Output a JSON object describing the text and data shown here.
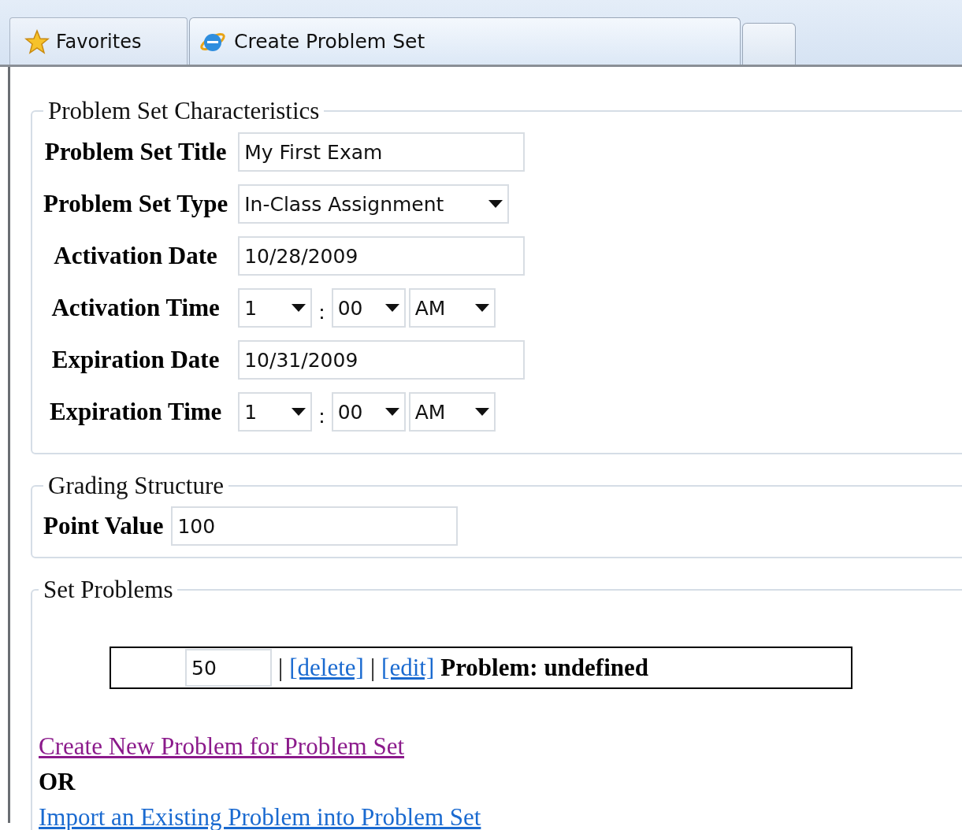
{
  "browser": {
    "favorites": "Favorites",
    "tabs": [
      {
        "title": "Create Problem Set",
        "selected": true
      }
    ]
  },
  "characteristics": {
    "legend": "Problem Set Characteristics",
    "fields": [
      {
        "kind": "text",
        "label": "Problem Set Title",
        "value": "My First Exam"
      },
      {
        "kind": "select",
        "label": "Problem Set Type",
        "value": "In-Class Assignment"
      },
      {
        "kind": "text",
        "label": "Activation Date",
        "value": "10/28/2009"
      },
      {
        "kind": "time",
        "label": "Activation Time",
        "hour": "1",
        "separator": ":",
        "minute": "00",
        "period": "AM"
      },
      {
        "kind": "text",
        "label": "Expiration Date",
        "value": "10/31/2009"
      },
      {
        "kind": "time",
        "label": "Expiration Time",
        "hour": "1",
        "separator": ":",
        "minute": "00",
        "period": "AM"
      }
    ]
  },
  "grading": {
    "legend": "Grading Structure",
    "label": "Point Value",
    "value": "100"
  },
  "problems": {
    "legend": "Set Problems",
    "rows": [
      {
        "points": "50",
        "separators": [
          "|",
          "|"
        ],
        "actions": [
          "[delete]",
          "[edit]"
        ],
        "title": "Problem: undefined"
      }
    ],
    "links": [
      {
        "label": "Create New Problem for Problem Set",
        "visited": true
      },
      {
        "label": "Import an Existing Problem into Problem Set",
        "visited": false
      }
    ],
    "or": "OR"
  }
}
